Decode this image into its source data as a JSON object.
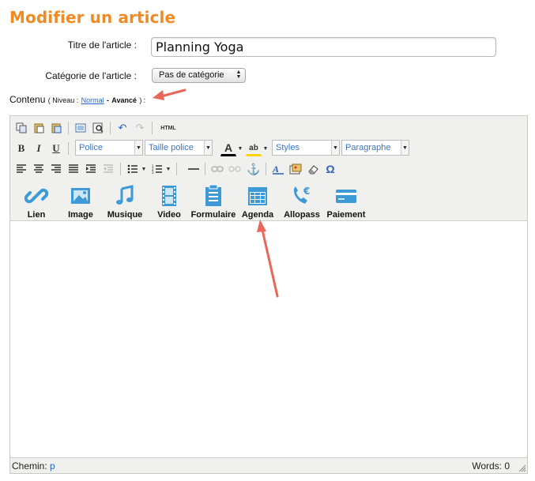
{
  "page": {
    "title": "Modifier un article"
  },
  "form": {
    "titre_label": "Titre de l'article :",
    "titre_value": "Planning Yoga",
    "categorie_label": "Catégorie de l'article :",
    "categorie_value": "Pas de catégorie"
  },
  "contenu": {
    "label": "Contenu",
    "niveau_prefix": "( Niveau :",
    "normal_link": "Normal",
    "dash": "-",
    "avance": "Avancé",
    "suffix": ") :"
  },
  "toolbar": {
    "row1": [
      "copy-icon",
      "paste-icon",
      "paste-word-icon",
      "fullscreen-icon",
      "preview-icon",
      "undo-icon",
      "redo-icon",
      "html-icon"
    ],
    "html_label": "HTML",
    "bold": "B",
    "italic": "I",
    "underline": "U",
    "font_combo": "Police",
    "size_combo": "Taille police",
    "styles_combo": "Styles",
    "format_combo": "Paragraphe",
    "text_color_label": "A",
    "bg_color_label": "ab",
    "omega": "Ω",
    "big_buttons": [
      {
        "label": "Lien",
        "icon": "link-icon"
      },
      {
        "label": "Image",
        "icon": "image-icon"
      },
      {
        "label": "Musique",
        "icon": "music-icon"
      },
      {
        "label": "Video",
        "icon": "film-icon"
      },
      {
        "label": "Formulaire",
        "icon": "clipboard-icon"
      },
      {
        "label": "Agenda",
        "icon": "calendar-icon"
      },
      {
        "label": "Allopass",
        "icon": "phone-euro-icon"
      },
      {
        "label": "Paiement",
        "icon": "credit-card-icon"
      }
    ]
  },
  "status": {
    "path_label": "Chemin:",
    "path_value": "p",
    "words": "Words: 0"
  },
  "colors": {
    "title": "#f08a24",
    "icon_blue": "#3d9ad6",
    "link": "#2a66c8",
    "arrow": "#e8675a"
  }
}
